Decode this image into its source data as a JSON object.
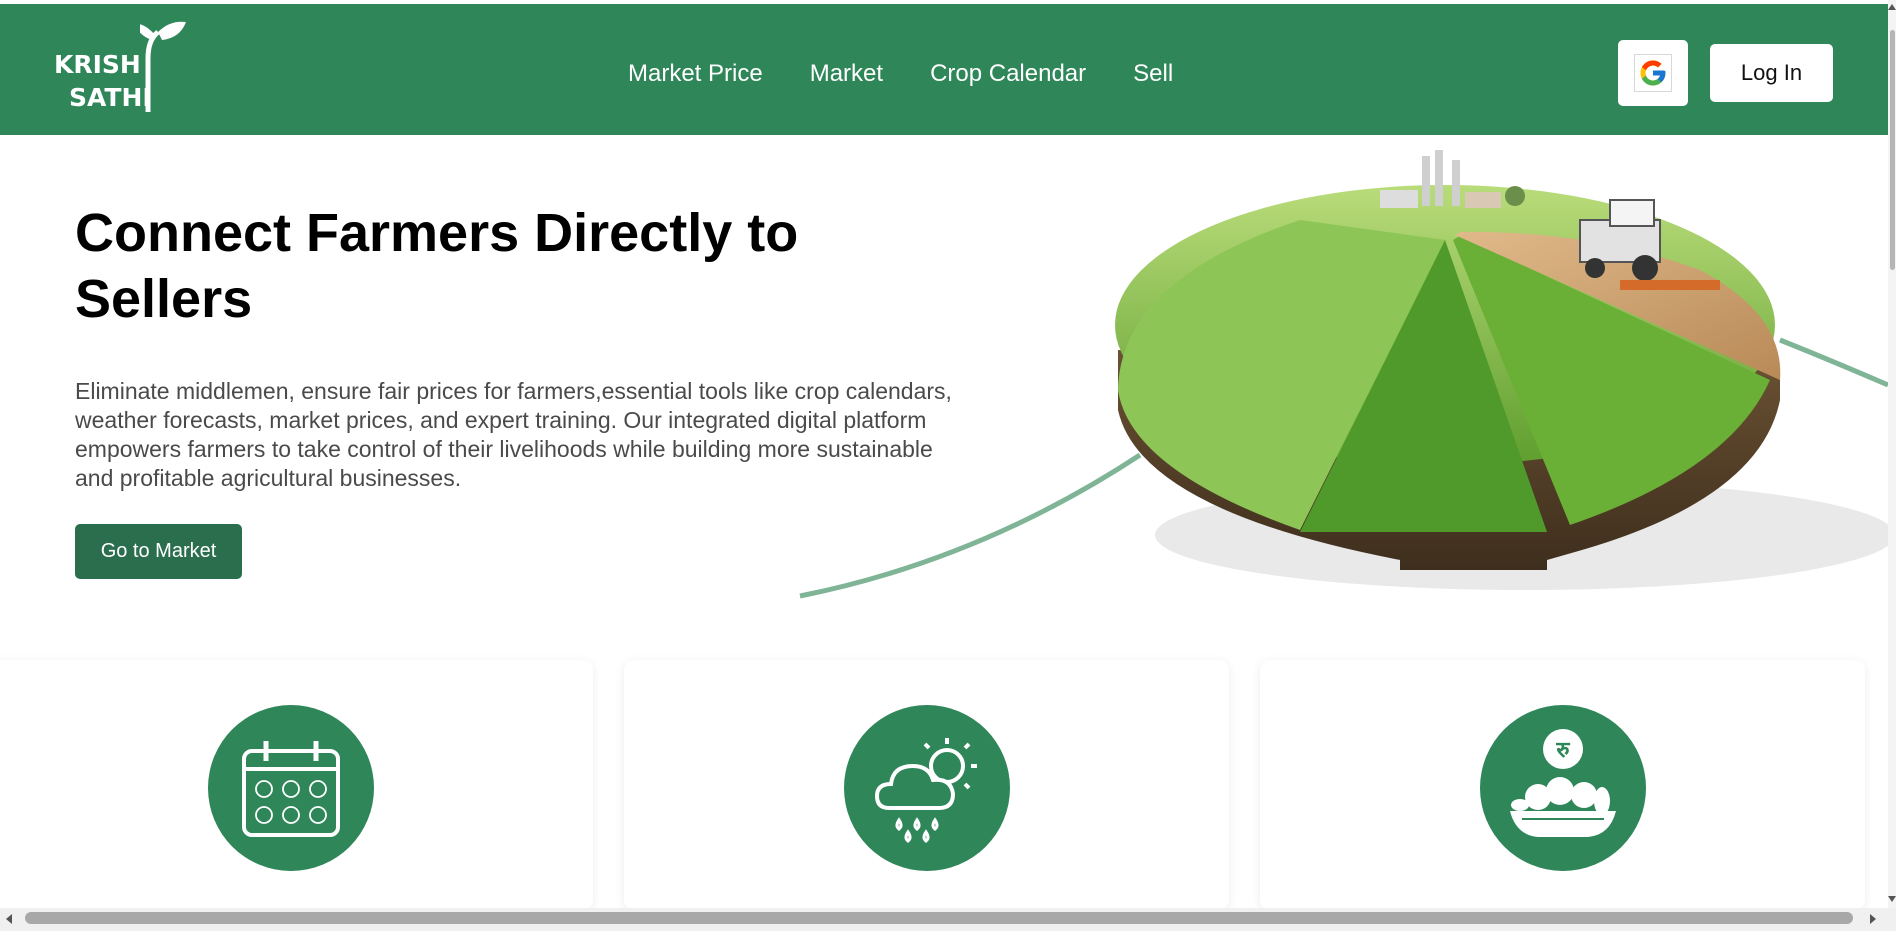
{
  "logo": {
    "line1": "KRISH",
    "line2": "SATHI"
  },
  "nav": {
    "items": [
      {
        "label": "Market Price"
      },
      {
        "label": "Market"
      },
      {
        "label": "Crop Calendar"
      },
      {
        "label": "Sell"
      }
    ]
  },
  "auth": {
    "google_icon": "google-g-icon",
    "login_label": "Log In"
  },
  "hero": {
    "title": "Connect Farmers Directly to Sellers",
    "description": "Eliminate middlemen, ensure fair prices for farmers,essential tools like crop calendars, weather forecasts, market prices, and expert training. Our integrated digital platform empowers farmers to take control of their livelihoods while building more sustainable and profitable agricultural businesses.",
    "cta_label": "Go to Market",
    "image_icon": "farmland-pie-illustration"
  },
  "cards": [
    {
      "icon": "crop-calendar-icon"
    },
    {
      "icon": "weather-icon"
    },
    {
      "icon": "market-price-basket-icon",
      "currency_symbol": "रु"
    }
  ],
  "colors": {
    "brand": "#2e8659",
    "cta": "#2a6e4e",
    "white": "#ffffff",
    "text_body": "#4a4a4a"
  }
}
